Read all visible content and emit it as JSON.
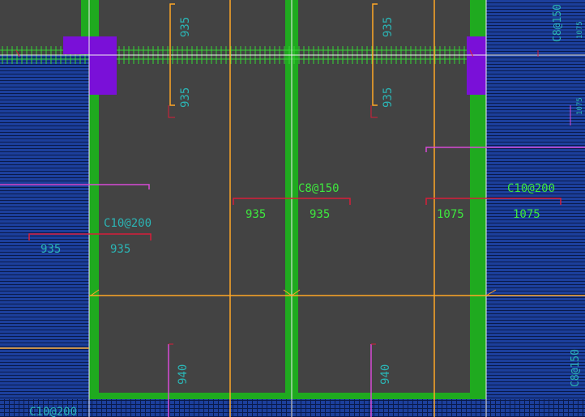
{
  "viewport": {
    "bg_color": "#434343",
    "colors": {
      "slab_hatch": "#1c3f9c",
      "hatch_line": "#0a1a4a",
      "wall": "#1faa1f",
      "column": "#7a10d8",
      "rebar_orange": "#ffa826",
      "rebar_magenta": "#d84bd6",
      "rebar_red": "#d81e3a",
      "grid_white": "#f0f0f0",
      "text_cyan": "#2bb5b5",
      "text_green": "#3ee83e",
      "mesh_green": "#36d636"
    }
  },
  "labels": {
    "top_left_upper": "935",
    "top_left_lower": "935",
    "top_right_upper": "935",
    "top_right_lower": "935",
    "far_right_rotated": "C8@150",
    "far_right_small": "1075",
    "far_right_small2": "1075",
    "center_spec": "C8@150",
    "center_left_dim": "935",
    "center_right_dim": "935",
    "right_spec": "C10@200",
    "right_dim_left": "1075",
    "right_dim_right": "1075",
    "left_spec": "C10@200",
    "left_dim_left": "935",
    "left_dim_right": "935",
    "bottom_left_rot": "940",
    "bottom_mid_rot": "940",
    "bottom_right_rot": "C8@150",
    "bottom_left_spec": "C10@200"
  }
}
